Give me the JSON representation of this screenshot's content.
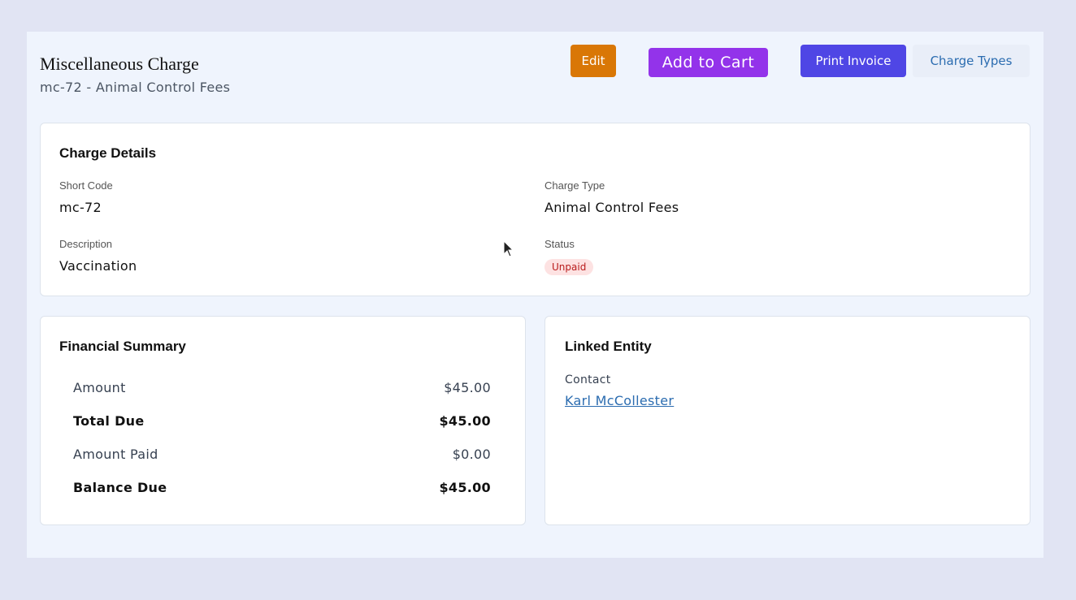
{
  "header": {
    "title": "Miscellaneous Charge",
    "subtitle": "mc-72 - Animal Control Fees"
  },
  "actions": {
    "edit_label": "Edit",
    "add_to_cart_label": "Add to Cart",
    "print_invoice_label": "Print Invoice",
    "charge_types_label": "Charge Types"
  },
  "details": {
    "heading": "Charge Details",
    "short_code_label": "Short Code",
    "short_code_value": "mc-72",
    "charge_type_label": "Charge Type",
    "charge_type_value": "Animal Control Fees",
    "description_label": "Description",
    "description_value": "Vaccination",
    "status_label": "Status",
    "status_value": "Unpaid"
  },
  "financial": {
    "heading": "Financial Summary",
    "rows": [
      {
        "label": "Amount",
        "value": "$45.00",
        "bold": false
      },
      {
        "label": "Total Due",
        "value": "$45.00",
        "bold": true
      },
      {
        "label": "Amount Paid",
        "value": "$0.00",
        "bold": false
      },
      {
        "label": "Balance Due",
        "value": "$45.00",
        "bold": true
      }
    ]
  },
  "linked": {
    "heading": "Linked Entity",
    "contact_label": "Contact",
    "contact_name": "Karl McCollester"
  },
  "colors": {
    "edit": "#d97706",
    "add_to_cart": "#9333ea",
    "print_invoice": "#4f46e5",
    "status_unpaid_bg": "#fde2e2",
    "status_unpaid_text": "#b91c1c"
  }
}
